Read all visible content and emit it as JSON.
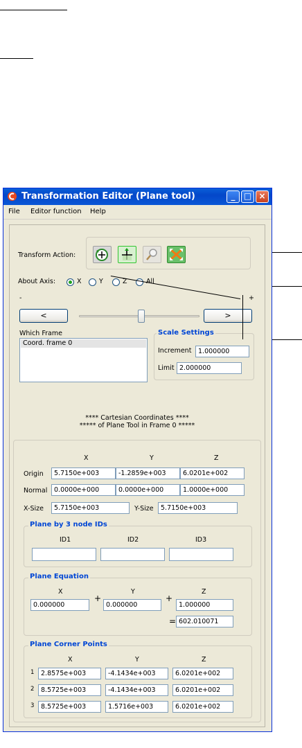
{
  "window": {
    "title": "Transformation Editor (Plane tool)",
    "minimize": "_",
    "maximize": "□",
    "close": "×"
  },
  "menu": [
    "File",
    "Editor function",
    "Help"
  ],
  "transform": {
    "label": "Transform Action:",
    "icons": [
      "rotate-icon",
      "translate-icon",
      "zoom-icon",
      "scale-icon"
    ]
  },
  "axis": {
    "label": "About Axis:",
    "options": [
      "X",
      "Y",
      "Z",
      "All"
    ],
    "selected": "X"
  },
  "slider": {
    "minus": "-",
    "plus": "+",
    "left_button": "<",
    "right_button": ">",
    "position": 0.52
  },
  "frame": {
    "label": "Which Frame",
    "items": [
      "Coord. frame 0"
    ]
  },
  "scale": {
    "title": "Scale Settings",
    "increment_label": "Increment",
    "increment": "1.000000",
    "limit_label": "Limit",
    "limit": "2.000000"
  },
  "coords_header": {
    "line1": "**** Cartesian Coordinates ****",
    "line2": "***** of Plane Tool in Frame 0 *****"
  },
  "cartesian": {
    "col_x": "X",
    "col_y": "Y",
    "col_z": "Z",
    "origin_label": "Origin",
    "origin": [
      "5.7150e+003",
      "-1.2859e+003",
      "6.0201e+002"
    ],
    "normal_label": "Normal",
    "normal": [
      "0.0000e+000",
      "0.0000e+000",
      "1.0000e+000"
    ],
    "xsize_label": "X-Size",
    "xsize": "5.7150e+003",
    "ysize_label": "Y-Size",
    "ysize": "5.7150e+003"
  },
  "node_ids": {
    "title": "Plane by 3 node IDs",
    "labels": [
      "ID1",
      "ID2",
      "ID3"
    ],
    "values": [
      "",
      "",
      ""
    ]
  },
  "equation": {
    "title": "Plane Equation",
    "col_x": "X",
    "col_y": "Y",
    "col_z": "Z",
    "plus": "+",
    "equals": "=",
    "x": "0.000000",
    "y": "0.000000",
    "z": "1.000000",
    "result": "602.010071"
  },
  "corners": {
    "title": "Plane Corner Points",
    "col_x": "X",
    "col_y": "Y",
    "col_z": "Z",
    "rows": [
      {
        "n": "1",
        "x": "2.8575e+003",
        "y": "-4.1434e+003",
        "z": "6.0201e+002"
      },
      {
        "n": "2",
        "x": "8.5725e+003",
        "y": "-4.1434e+003",
        "z": "6.0201e+002"
      },
      {
        "n": "3",
        "x": "8.5725e+003",
        "y": "1.5716e+003",
        "z": "6.0201e+002"
      }
    ]
  }
}
